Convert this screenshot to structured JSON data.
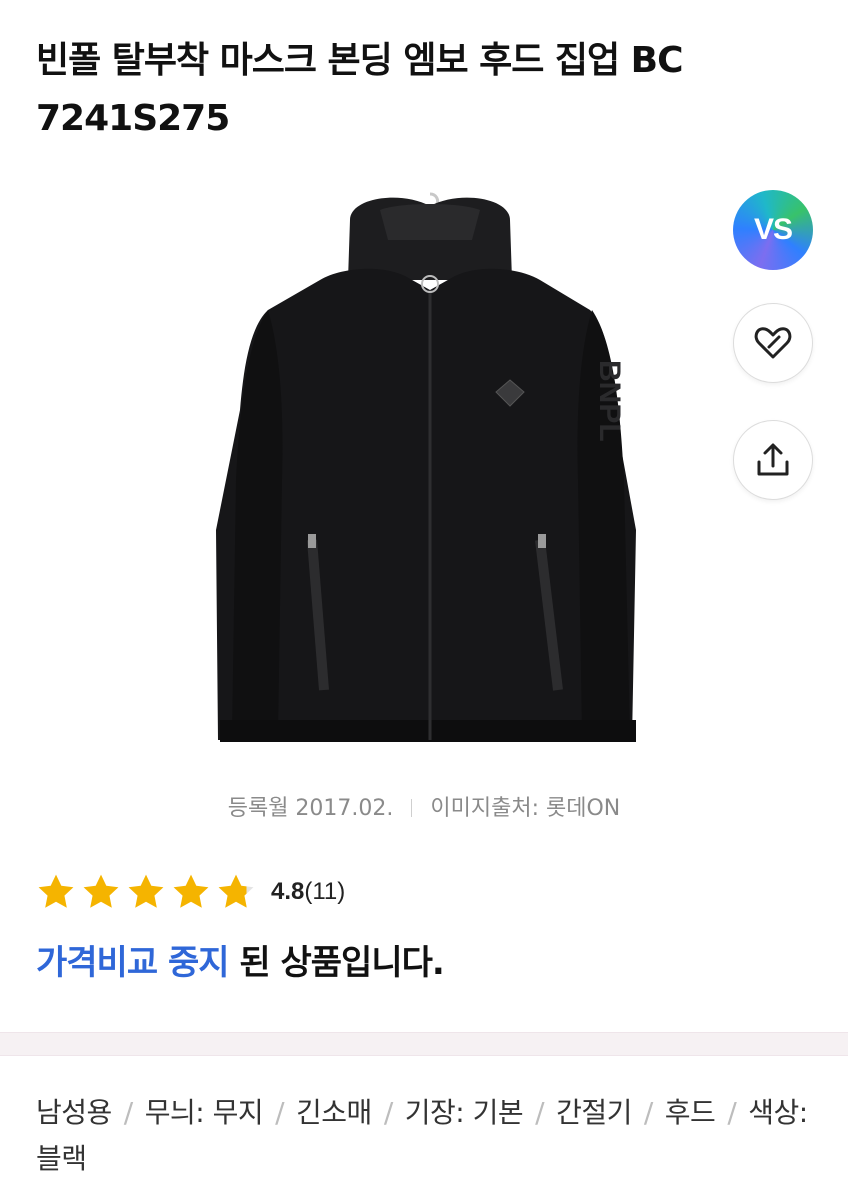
{
  "product": {
    "title_line1": "빈폴 탈부착 마스크 본딩 엠보 후드 집업 BC",
    "title_line2": "7241S275",
    "image_alt": "빈폴 후드 집업 블랙"
  },
  "side_actions": {
    "vs_label": "VS",
    "like_icon": "heart-icon",
    "share_icon": "share-icon"
  },
  "meta": {
    "registered": "등록월 2017.02.",
    "image_source": "이미지출처: 롯데ON"
  },
  "rating": {
    "score": "4.8",
    "count": "(11)",
    "stars_filled": 4.8,
    "stars_total": 5,
    "star_color": "#f5b400"
  },
  "status": {
    "highlight": "가격비교 중지",
    "rest": " 된 상품입니다.",
    "highlight_color": "#2f67d8"
  },
  "specs": {
    "items": [
      "남성용",
      "무늬: 무지",
      "긴소매",
      "기장: 기본",
      "간절기",
      "후드",
      "색상: 블랙"
    ]
  }
}
